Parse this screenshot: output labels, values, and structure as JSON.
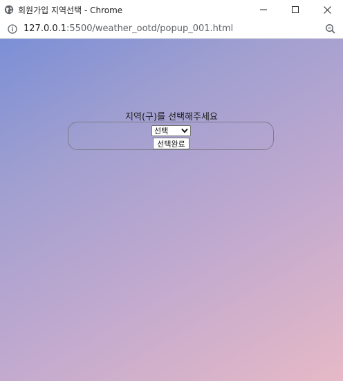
{
  "window": {
    "title": "회원가입 지역선택 - Chrome"
  },
  "address": {
    "host": "127.0.0.1",
    "rest": ":5500/weather_ootd/popup_001.html"
  },
  "icons": {
    "site": "globe-icon",
    "info": "info-icon",
    "zoom": "zoom-icon",
    "minimize": "minimize-icon",
    "maximize": "maximize-icon",
    "close": "close-icon"
  },
  "form": {
    "prompt": "지역(구)를 선택해주세요",
    "select_value": "선택",
    "submit_label": "선택완료"
  },
  "colors": {
    "gradient_start": "#7b8fd6",
    "gradient_end": "#e6b9c6"
  }
}
